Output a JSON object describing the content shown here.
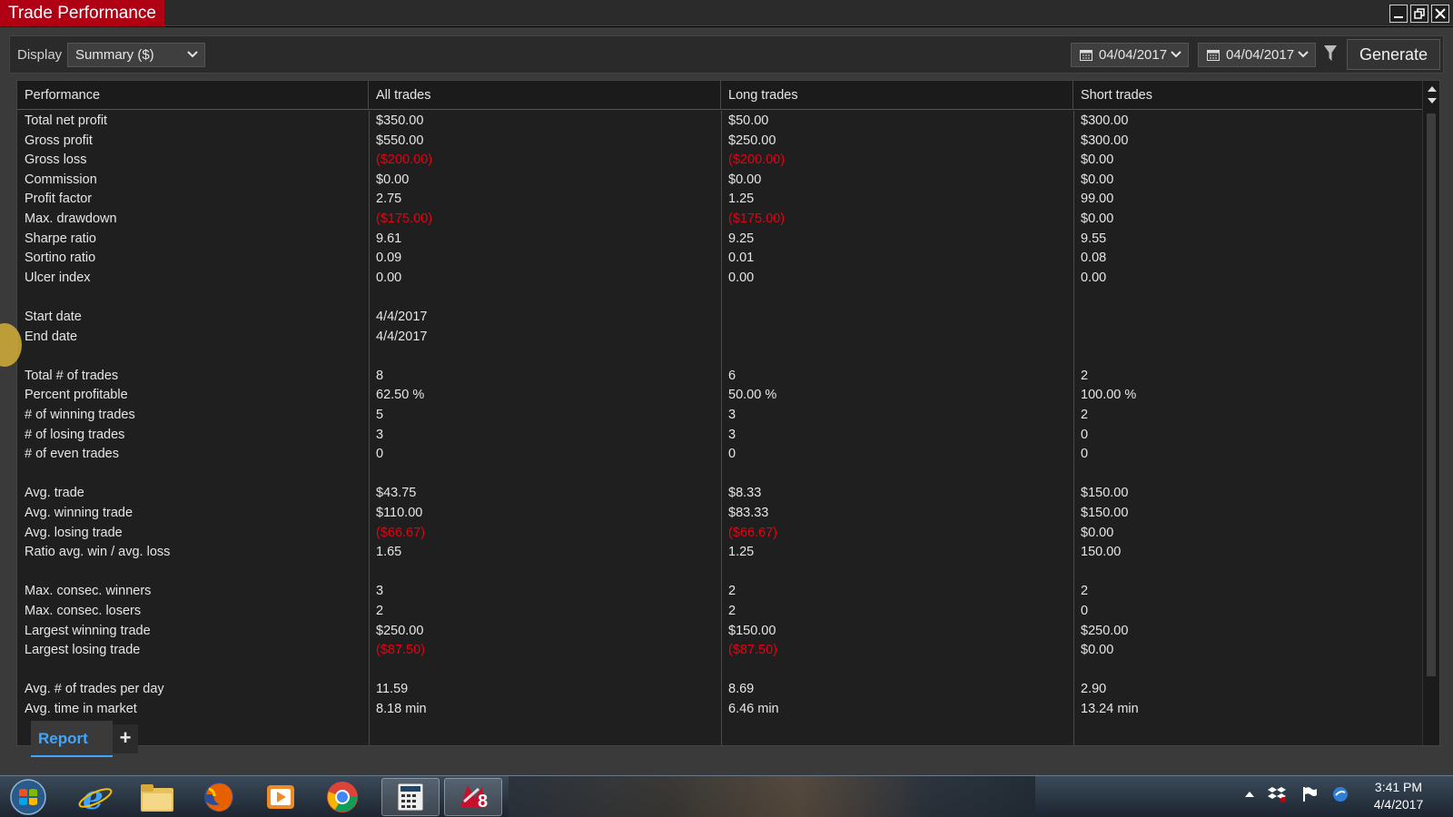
{
  "window": {
    "title": "Trade Performance"
  },
  "toolbar": {
    "display_label": "Display",
    "display_value": "Summary ($)",
    "from_date": "04/04/2017",
    "to_date": "04/04/2017",
    "generate_label": "Generate"
  },
  "table": {
    "headers": [
      "Performance",
      "All trades",
      "Long trades",
      "Short trades"
    ],
    "rows": [
      {
        "label": "Total net profit",
        "all": "$350.00",
        "long": "$50.00",
        "short": "$300.00"
      },
      {
        "label": "Gross profit",
        "all": "$550.00",
        "long": "$250.00",
        "short": "$300.00"
      },
      {
        "label": "Gross loss",
        "all": "($200.00)",
        "long": "($200.00)",
        "short": "$0.00"
      },
      {
        "label": "Commission",
        "all": "$0.00",
        "long": "$0.00",
        "short": "$0.00"
      },
      {
        "label": "Profit factor",
        "all": "2.75",
        "long": "1.25",
        "short": "99.00"
      },
      {
        "label": "Max. drawdown",
        "all": "($175.00)",
        "long": "($175.00)",
        "short": "$0.00"
      },
      {
        "label": "Sharpe ratio",
        "all": "9.61",
        "long": "9.25",
        "short": "9.55"
      },
      {
        "label": "Sortino ratio",
        "all": "0.09",
        "long": "0.01",
        "short": "0.08"
      },
      {
        "label": "Ulcer index",
        "all": "0.00",
        "long": "0.00",
        "short": "0.00"
      },
      {
        "label": "",
        "all": "",
        "long": "",
        "short": ""
      },
      {
        "label": "Start date",
        "all": "4/4/2017",
        "long": "",
        "short": ""
      },
      {
        "label": "End date",
        "all": "4/4/2017",
        "long": "",
        "short": ""
      },
      {
        "label": "",
        "all": "",
        "long": "",
        "short": ""
      },
      {
        "label": "Total # of trades",
        "all": "8",
        "long": "6",
        "short": "2"
      },
      {
        "label": "Percent profitable",
        "all": "62.50 %",
        "long": "50.00 %",
        "short": "100.00 %"
      },
      {
        "label": "# of winning trades",
        "all": "5",
        "long": "3",
        "short": "2"
      },
      {
        "label": "# of losing trades",
        "all": "3",
        "long": "3",
        "short": "0"
      },
      {
        "label": "# of even trades",
        "all": "0",
        "long": "0",
        "short": "0"
      },
      {
        "label": "",
        "all": "",
        "long": "",
        "short": ""
      },
      {
        "label": "Avg. trade",
        "all": "$43.75",
        "long": "$8.33",
        "short": "$150.00"
      },
      {
        "label": "Avg. winning trade",
        "all": "$110.00",
        "long": "$83.33",
        "short": "$150.00"
      },
      {
        "label": "Avg. losing trade",
        "all": "($66.67)",
        "long": "($66.67)",
        "short": "$0.00"
      },
      {
        "label": "Ratio avg. win / avg. loss",
        "all": "1.65",
        "long": "1.25",
        "short": "150.00"
      },
      {
        "label": "",
        "all": "",
        "long": "",
        "short": ""
      },
      {
        "label": "Max. consec. winners",
        "all": "3",
        "long": "2",
        "short": "2"
      },
      {
        "label": "Max. consec. losers",
        "all": "2",
        "long": "2",
        "short": "0"
      },
      {
        "label": "Largest winning trade",
        "all": "$250.00",
        "long": "$150.00",
        "short": "$250.00"
      },
      {
        "label": "Largest losing trade",
        "all": "($87.50)",
        "long": "($87.50)",
        "short": "$0.00"
      },
      {
        "label": "",
        "all": "",
        "long": "",
        "short": ""
      },
      {
        "label": "Avg. # of trades per day",
        "all": "11.59",
        "long": "8.69",
        "short": "2.90"
      },
      {
        "label": "Avg. time in market",
        "all": "8.18 min",
        "long": "6.46 min",
        "short": "13.24 min"
      }
    ]
  },
  "tabs": {
    "active_label": "Report",
    "add_label": "+"
  },
  "taskbar": {
    "time": "3:41 PM",
    "date": "4/4/2017",
    "ninja_badge": "8"
  },
  "colors": {
    "title_bg": "#b00014",
    "negative": "#e60012",
    "tab_accent": "#3fa7ff"
  }
}
